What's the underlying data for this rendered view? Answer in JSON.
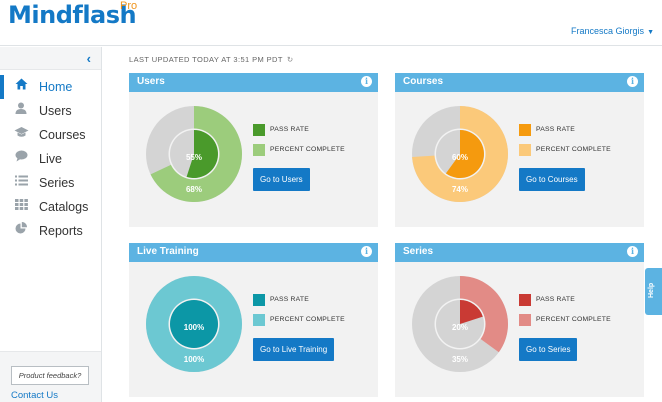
{
  "app": {
    "logo": "Mindflash",
    "logo_badge": "Pro"
  },
  "user_menu": {
    "name": "Francesca Giorgis"
  },
  "sidebar": {
    "items": [
      {
        "label": "Home",
        "icon": "home-icon",
        "active": true
      },
      {
        "label": "Users",
        "icon": "user-icon",
        "active": false
      },
      {
        "label": "Courses",
        "icon": "graduation-cap-icon",
        "active": false
      },
      {
        "label": "Live",
        "icon": "chat-bubble-icon",
        "active": false
      },
      {
        "label": "Series",
        "icon": "list-icon",
        "active": false
      },
      {
        "label": "Catalogs",
        "icon": "grid-icon",
        "active": false
      },
      {
        "label": "Reports",
        "icon": "pie-chart-icon",
        "active": false
      }
    ],
    "feedback_label": "Product feedback?",
    "contact_label": "Contact Us"
  },
  "main": {
    "last_updated": "LAST UPDATED TODAY AT 3:51 PM PDT"
  },
  "cards": [
    {
      "title": "Users",
      "pass_label": "PASS RATE",
      "complete_label": "PERCENT COMPLETE",
      "pass_value": 55,
      "complete_value": 68,
      "pass_text": "55%",
      "complete_text": "68%",
      "dark": "#4a9a2b",
      "light": "#9ccc7c",
      "button": "Go to Users"
    },
    {
      "title": "Courses",
      "pass_label": "PASS RATE",
      "complete_label": "PERCENT COMPLETE",
      "pass_value": 60,
      "complete_value": 74,
      "pass_text": "60%",
      "complete_text": "74%",
      "dark": "#f59a0e",
      "light": "#fbc97a",
      "button": "Go to Courses"
    },
    {
      "title": "Live Training",
      "pass_label": "PASS RATE",
      "complete_label": "PERCENT COMPLETE",
      "pass_value": 100,
      "complete_value": 100,
      "pass_text": "100%",
      "complete_text": "100%",
      "dark": "#0c97a6",
      "light": "#6cc8d2",
      "button": "Go to Live Training"
    },
    {
      "title": "Series",
      "pass_label": "PASS RATE",
      "complete_label": "PERCENT COMPLETE",
      "pass_value": 20,
      "complete_value": 35,
      "pass_text": "20%",
      "complete_text": "35%",
      "dark": "#c93a34",
      "light": "#e28b86",
      "button": "Go to Series"
    }
  ],
  "help_label": "Help",
  "colors": {
    "brand": "#1479c6",
    "header": "#5cb3e2",
    "track": "#d4d4d4"
  }
}
